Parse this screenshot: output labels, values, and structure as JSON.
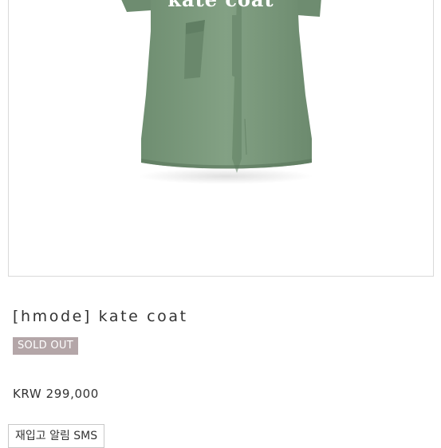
{
  "product": {
    "image_overlay_text": "kate coat",
    "title": "[hmode] kate coat",
    "status_badge": "SOLD OUT",
    "price": "KRW 299,000",
    "restock_sms_label": "재입고 알림 SMS"
  },
  "colors": {
    "coat_green": "#7d9b7e",
    "badge_bg": "#b4a6a8"
  }
}
